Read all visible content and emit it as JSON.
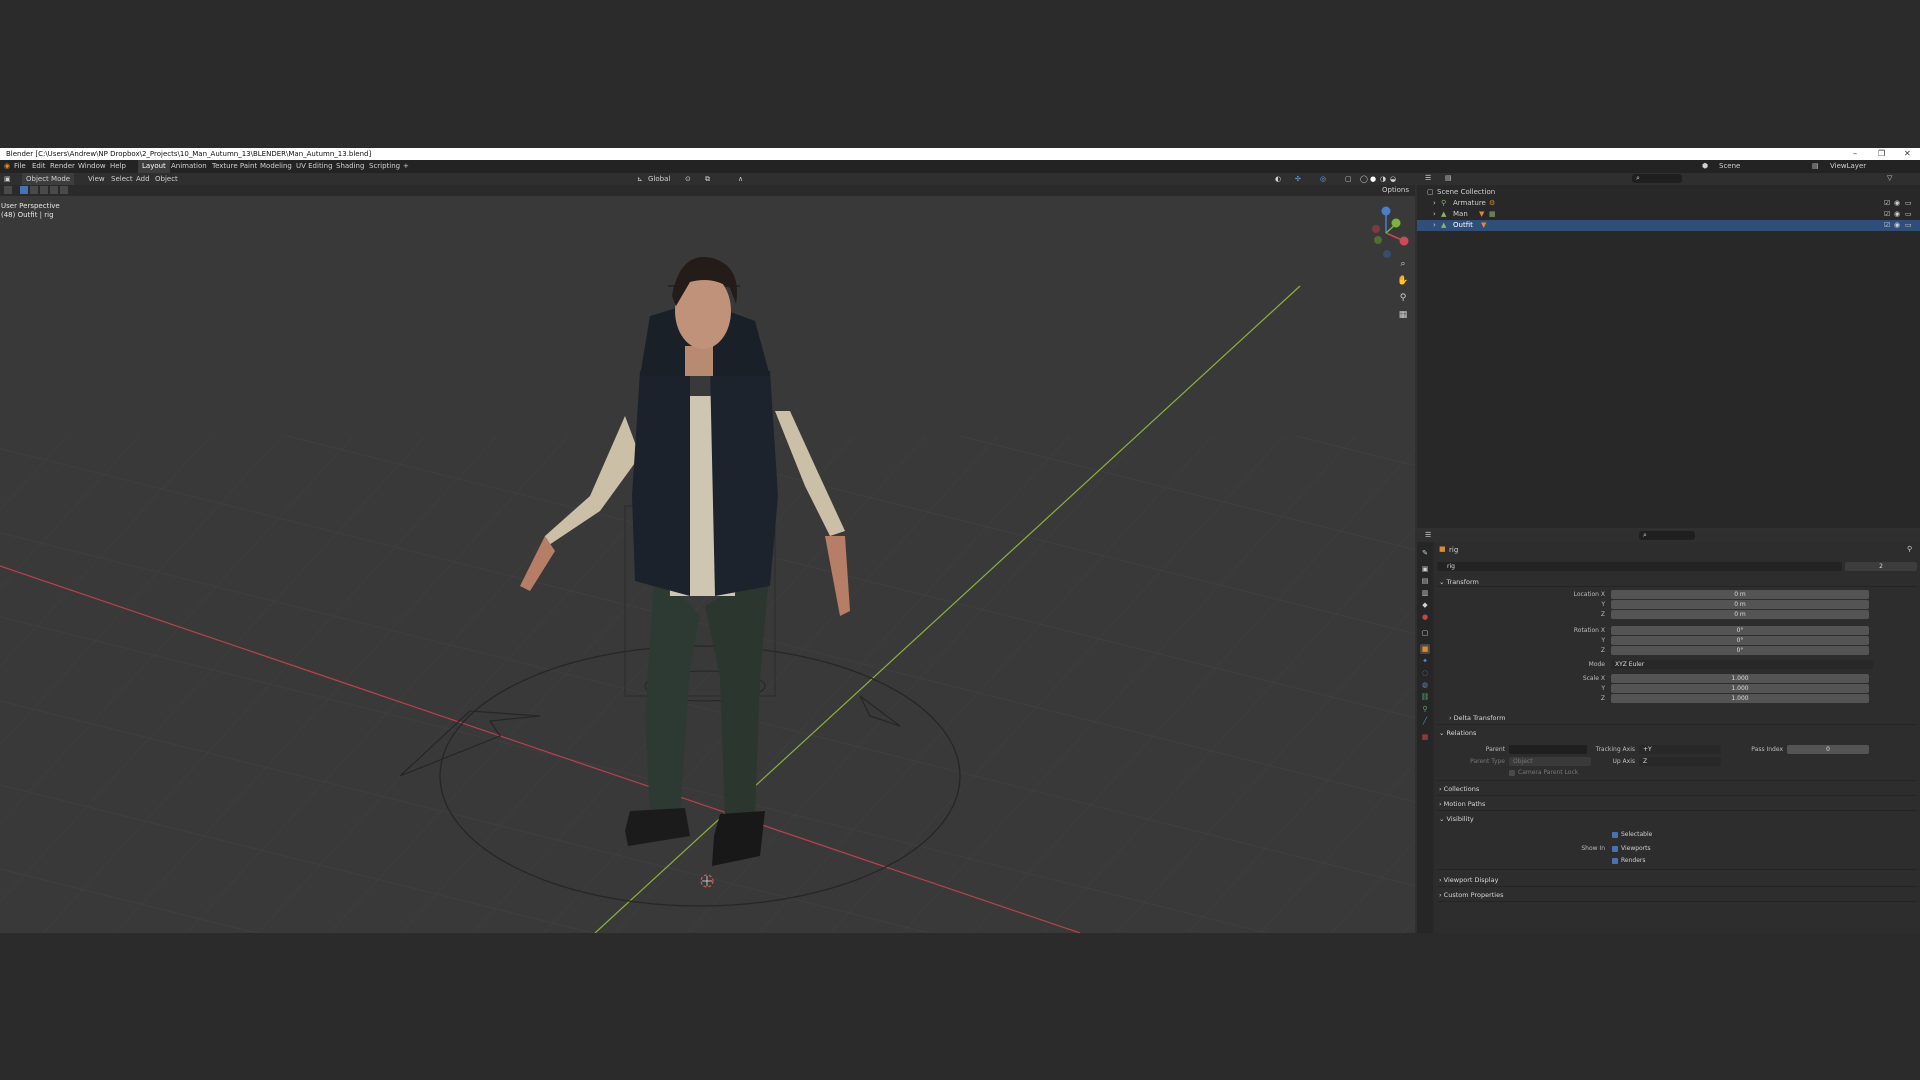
{
  "window": {
    "title": "Blender [C:\\Users\\Andrew\\NP Dropbox\\2_Projects\\10_Man_Autumn_13\\BLENDER\\Man_Autumn_13.blend]",
    "controls": [
      "–",
      "❐",
      "✕"
    ]
  },
  "menu": {
    "items": [
      "File",
      "Edit",
      "Render",
      "Window",
      "Help"
    ],
    "workspaces": [
      "Layout",
      "Animation",
      "Texture Paint",
      "Modeling",
      "UV Editing",
      "Shading",
      "Scripting",
      "+"
    ],
    "active_workspace": "Layout",
    "scene": "Scene",
    "view_layer": "ViewLayer"
  },
  "viewport": {
    "mode": "Object Mode",
    "menus": [
      "View",
      "Select",
      "Add",
      "Object"
    ],
    "orientation": "Global",
    "options": "Options",
    "overlay_title": "User Perspective",
    "overlay_subtitle": "(48) Outfit | rig",
    "gizmo_axes": [
      "X",
      "Y",
      "Z"
    ],
    "nav_icons": [
      "zoom-icon",
      "hand-pan-icon",
      "camera-icon",
      "grid-icon"
    ],
    "colors": {
      "x_axis": "#b8414e",
      "y_axis": "#8bb23a",
      "floor": "#3b3b3b"
    }
  },
  "outliner": {
    "root": "Scene Collection",
    "items": [
      {
        "name": "Armature",
        "selected": false
      },
      {
        "name": "Man",
        "selected": false
      },
      {
        "name": "Outfit",
        "selected": true
      }
    ]
  },
  "properties": {
    "object_name": "rig",
    "data_name": "rig",
    "data_users": "2",
    "transform": {
      "title": "Transform",
      "location_label": "Location X",
      "rotation_label": "Rotation X",
      "scale_label": "Scale X",
      "y": "Y",
      "z": "Z",
      "location": [
        "0 m",
        "0 m",
        "0 m"
      ],
      "rotation": [
        "0°",
        "0°",
        "0°"
      ],
      "mode_label": "Mode",
      "mode": "XYZ Euler",
      "scale": [
        "1.000",
        "1.000",
        "1.000"
      ],
      "delta": "Delta Transform"
    },
    "relations": {
      "title": "Relations",
      "parent_label": "Parent",
      "parent_type_label": "Parent Type",
      "parent_type": "Object",
      "camera_parent_lock": "Camera Parent Lock",
      "tracking_axis_label": "Tracking Axis",
      "tracking_axis": "+Y",
      "up_axis_label": "Up Axis",
      "up_axis": "Z",
      "pass_index_label": "Pass Index",
      "pass_index": "0"
    },
    "collections": "Collections",
    "motion_paths": "Motion Paths",
    "visibility": {
      "title": "Visibility",
      "selectable": "Selectable",
      "show_in_label": "Show In",
      "viewports": "Viewports",
      "renders": "Renders"
    },
    "viewport_display": "Viewport Display",
    "custom_properties": "Custom Properties"
  }
}
